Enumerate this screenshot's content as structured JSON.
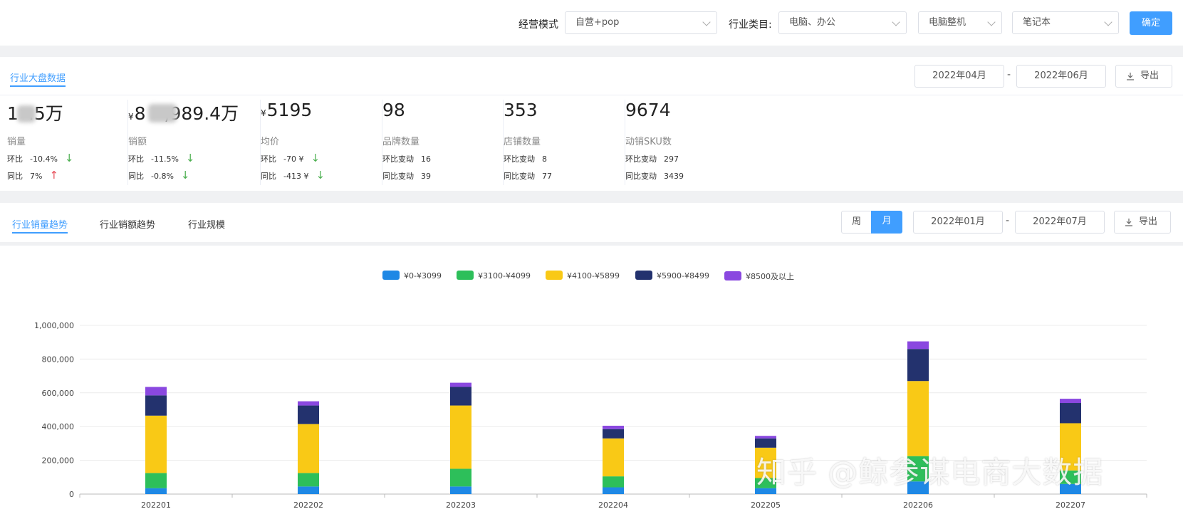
{
  "filters": {
    "mode_label": "经营模式",
    "mode_value": "自营+pop",
    "category_label": "行业类目:",
    "category_value": "电脑、办公",
    "subcategory_value": "电脑整机",
    "product_value": "笔记本",
    "confirm_label": "确定"
  },
  "overview": {
    "tab_label": "行业大盘数据",
    "date_start": "2022年04月",
    "date_sep": "-",
    "date_end": "2022年06月",
    "export_label": "导出",
    "stats": [
      {
        "prefix": "",
        "value_pre": "1",
        "value_post": ".5万",
        "label": "销量",
        "line1_label": "环比",
        "line1_value": "-10.4%",
        "line1_dir": "down",
        "line2_label": "同比",
        "line2_value": "7%",
        "line2_dir": "up"
      },
      {
        "prefix": "¥",
        "value_pre": "8",
        "value_post": ",989.4万",
        "label": "销额",
        "line1_label": "环比",
        "line1_value": "-11.5%",
        "line1_dir": "down",
        "line2_label": "同比",
        "line2_value": "-0.8%",
        "line2_dir": "down"
      },
      {
        "prefix": "¥",
        "value_pre": "5195",
        "value_post": "",
        "label": "均价",
        "line1_label": "环比",
        "line1_value": "-70 ¥",
        "line1_dir": "down",
        "line2_label": "同比",
        "line2_value": "-413 ¥",
        "line2_dir": "down"
      },
      {
        "prefix": "",
        "value_pre": "98",
        "value_post": "",
        "label": "品牌数量",
        "line1_label": "环比变动",
        "line1_value": "16",
        "line1_dir": "",
        "line2_label": "同比变动",
        "line2_value": "39",
        "line2_dir": ""
      },
      {
        "prefix": "",
        "value_pre": "353",
        "value_post": "",
        "label": "店铺数量",
        "line1_label": "环比变动",
        "line1_value": "8",
        "line1_dir": "",
        "line2_label": "同比变动",
        "line2_value": "77",
        "line2_dir": ""
      },
      {
        "prefix": "",
        "value_pre": "9674",
        "value_post": "",
        "label": "动销SKU数",
        "line1_label": "环比变动",
        "line1_value": "297",
        "line1_dir": "",
        "line2_label": "同比变动",
        "line2_value": "3439",
        "line2_dir": ""
      }
    ]
  },
  "trend": {
    "tabs": [
      "行业销量趋势",
      "行业销额趋势",
      "行业规模"
    ],
    "active_tab": 0,
    "week_label": "周",
    "month_label": "月",
    "date_start": "2022年01月",
    "date_sep": "-",
    "date_end": "2022年07月",
    "export_label": "导出"
  },
  "watermark": "知乎 @鲸参谋电商大数据",
  "chart_data": {
    "type": "bar",
    "stacked": true,
    "categories": [
      "202201",
      "202202",
      "202203",
      "202204",
      "202205",
      "202206",
      "202207"
    ],
    "ylim": [
      0,
      1000000
    ],
    "yticks": [
      0,
      200000,
      400000,
      600000,
      800000,
      1000000
    ],
    "ytick_labels": [
      "0",
      "200,000",
      "400,000",
      "600,000",
      "800,000",
      "1,000,000"
    ],
    "grid": true,
    "legend_position": "top-center",
    "series": [
      {
        "name": "¥0-¥3099",
        "color": "#1e88e5",
        "values": [
          35000,
          45000,
          45000,
          40000,
          35000,
          75000,
          60000
        ]
      },
      {
        "name": "¥3100-¥4099",
        "color": "#2dbf5a",
        "values": [
          90000,
          80000,
          105000,
          65000,
          60000,
          150000,
          80000
        ]
      },
      {
        "name": "¥4100-¥5899",
        "color": "#f9c916",
        "values": [
          340000,
          290000,
          375000,
          225000,
          180000,
          445000,
          280000
        ]
      },
      {
        "name": "¥5900-¥8499",
        "color": "#23326e",
        "values": [
          120000,
          110000,
          110000,
          55000,
          55000,
          190000,
          120000
        ]
      },
      {
        "name": "¥8500及以上",
        "color": "#8a48e0",
        "values": [
          50000,
          25000,
          25000,
          20000,
          15000,
          45000,
          25000
        ]
      }
    ]
  }
}
